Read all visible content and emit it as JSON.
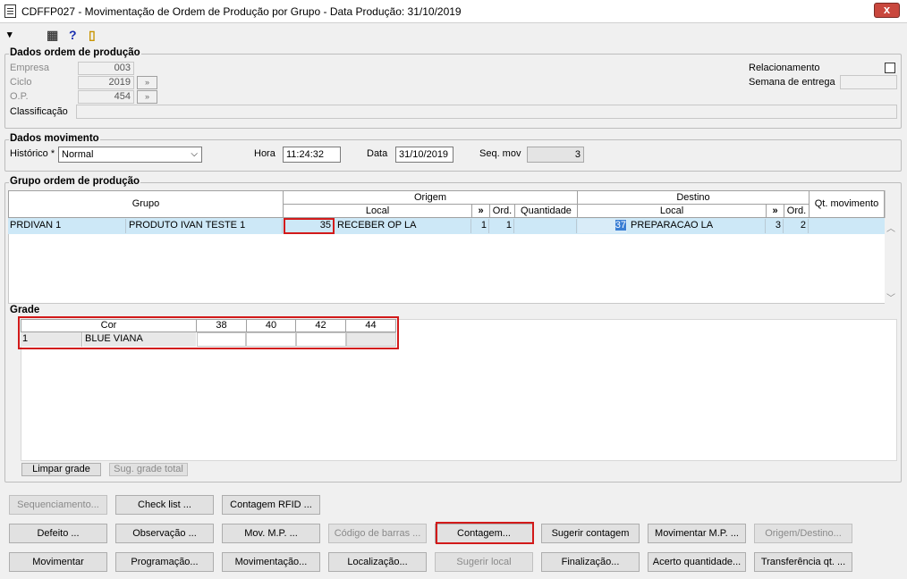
{
  "window": {
    "title": "CDFFP027 - Movimentação de Ordem de Produção por Grupo - Data Produção: 31/10/2019",
    "close_label": "x"
  },
  "toolbar": {
    "pin": "▾",
    "calc": "▦",
    "help": "?",
    "exit": "▯"
  },
  "dados_ordem": {
    "label": "Dados ordem de produção",
    "empresa_label": "Empresa",
    "empresa_value": "003",
    "ciclo_label": "Ciclo",
    "ciclo_value": "2019",
    "op_label": "O.P.",
    "op_value": "454",
    "classificacao_label": "Classificação",
    "classificacao_value": "",
    "relacionamento_label": "Relacionamento",
    "semana_label": "Semana de entrega",
    "semana_value": "",
    "lookup_glyph": "»"
  },
  "dados_movimento": {
    "label": "Dados movimento",
    "historico_label": "Histórico *",
    "historico_value": "Normal",
    "hora_label": "Hora",
    "hora_value": "11:24:32",
    "data_label": "Data",
    "data_value": "31/10/2019",
    "seqmov_label": "Seq. mov",
    "seqmov_value": "3"
  },
  "grupo": {
    "label": "Grupo ordem de produção",
    "headers": {
      "grupo": "Grupo",
      "origem": "Origem",
      "destino": "Destino",
      "local": "Local",
      "arrow": "»",
      "ord": "Ord.",
      "quantidade": "Quantidade",
      "qt_movimento": "Qt. movimento"
    },
    "row": {
      "code": "PRDIVAN 1",
      "name": "PRODUTO IVAN TESTE 1",
      "origem_num": "35",
      "origem_local": "RECEBER OP LA",
      "origem_arrow": "1",
      "origem_ord": "1",
      "quantidade": "",
      "destino_num": "37",
      "destino_local": "PREPARACAO LA",
      "destino_arrow": "3",
      "destino_ord": "2",
      "qt_movimento": ""
    }
  },
  "grade": {
    "label": "Grade",
    "headers": [
      "Cor",
      "38",
      "40",
      "42",
      "44"
    ],
    "row": {
      "num": "1",
      "cor": "BLUE VIANA",
      "v38": "",
      "v40": "",
      "v42": "",
      "v44": ""
    },
    "limpar_label": "Limpar grade",
    "sugerir_total_label": "Sug. grade total"
  },
  "buttons": {
    "sequenciamento": "Sequenciamento...",
    "checklist": "Check list ...",
    "contagem_rfid": "Contagem RFID ...",
    "defeito": "Defeito ...",
    "observacao": "Observação ...",
    "mov_mp": "Mov. M.P. ...",
    "codigo_barras": "Código de barras ...",
    "contagem": "Contagem...",
    "sugerir_contagem": "Sugerir contagem",
    "movimentar_mp": "Movimentar M.P. ...",
    "origem_destino": "Origem/Destino...",
    "movimentar": "Movimentar",
    "programacao": "Programação...",
    "movimentacao": "Movimentação...",
    "localizacao": "Localização...",
    "sugerir_local": "Sugerir local",
    "finalizacao": "Finalização...",
    "acerto_quantidade": "Acerto quantidade...",
    "transferencia": "Transferência qt. ..."
  },
  "scroll": {
    "up": "︿",
    "down": "﹀"
  }
}
